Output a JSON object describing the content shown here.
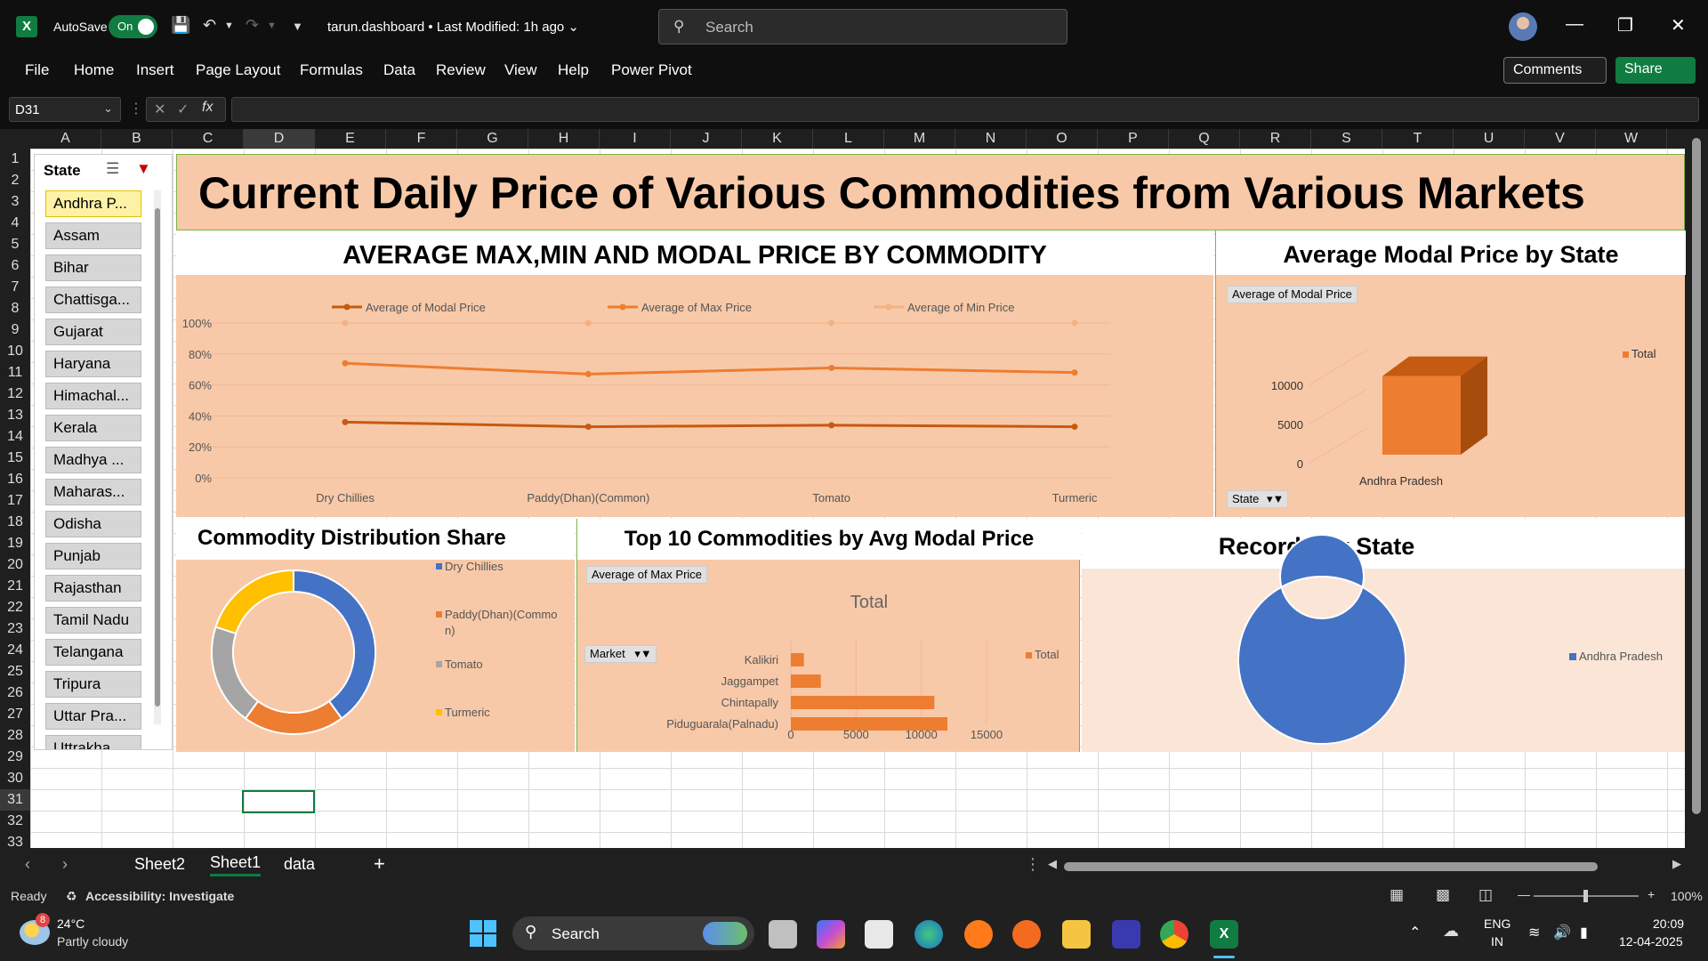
{
  "titlebar": {
    "autosave_label": "AutoSave",
    "autosave_state": "On",
    "doc_title": "tarun.dashboard  •  Last Modified: 1h ago",
    "search_placeholder": "Search"
  },
  "menu": {
    "items": [
      "File",
      "Home",
      "Insert",
      "Page Layout",
      "Formulas",
      "Data",
      "Review",
      "View",
      "Help",
      "Power Pivot"
    ],
    "comments": "Comments",
    "share": "Share"
  },
  "formula_bar": {
    "name_box": "D31",
    "formula": ""
  },
  "columns": [
    "A",
    "B",
    "C",
    "D",
    "E",
    "F",
    "G",
    "H",
    "I",
    "J",
    "K",
    "L",
    "M",
    "N",
    "O",
    "P",
    "Q",
    "R",
    "S",
    "T",
    "U",
    "V",
    "W"
  ],
  "rows": [
    "1",
    "2",
    "3",
    "4",
    "5",
    "6",
    "7",
    "8",
    "9",
    "10",
    "11",
    "12",
    "13",
    "14",
    "15",
    "16",
    "17",
    "18",
    "19",
    "20",
    "21",
    "22",
    "23",
    "24",
    "25",
    "26",
    "27",
    "28",
    "29",
    "30",
    "31",
    "32",
    "33"
  ],
  "slicer": {
    "title": "State",
    "items": [
      "Andhra P...",
      "Assam",
      "Bihar",
      "Chattisga...",
      "Gujarat",
      "Haryana",
      "Himachal...",
      "Kerala",
      "Madhya ...",
      "Maharas...",
      "Odisha",
      "Punjab",
      "Rajasthan",
      "Tamil Nadu",
      "Telangana",
      "Tripura",
      "Uttar Pra...",
      "Uttrakha..."
    ],
    "selected": 0
  },
  "dashboard": {
    "title": "Current Daily Price of Various Commodities from Various Markets",
    "colors": {
      "panel": "#f8c9a8",
      "orange": "#ed7d31",
      "dark_orange": "#c55a11",
      "blue": "#4472c4",
      "gray": "#a5a5a5",
      "yellow": "#ffc000",
      "accent_green": "#107c41"
    }
  },
  "chart_data": [
    {
      "type": "line",
      "title": "AVERAGE MAX,MIN AND MODAL PRICE BY COMMODITY",
      "categories": [
        "Dry Chillies",
        "Paddy(Dhan)(Common)",
        "Tomato",
        "Turmeric"
      ],
      "y_ticks": [
        "100%",
        "80%",
        "60%",
        "40%",
        "20%",
        "0%"
      ],
      "ylim": [
        0,
        100
      ],
      "series": [
        {
          "name": "Average of Modal Price",
          "color": "#c55a11",
          "values": [
            36,
            33,
            34,
            33
          ]
        },
        {
          "name": "Average of Max Price",
          "color": "#ed7d31",
          "values": [
            74,
            67,
            71,
            68
          ]
        },
        {
          "name": "Average of Min Price",
          "color": "#f4b183",
          "values": [
            100,
            100,
            100,
            100
          ]
        }
      ],
      "legend": "top"
    },
    {
      "type": "bar",
      "title": "Average Modal Price by State",
      "field_button": "Average of Modal Price",
      "filter_button": "State",
      "categories": [
        "Andhra Pradesh"
      ],
      "series": [
        {
          "name": "Total",
          "values": [
            8000
          ]
        }
      ],
      "y_ticks": [
        "10000",
        "5000",
        "0"
      ],
      "ylim": [
        0,
        10000
      ],
      "legend": "right"
    },
    {
      "type": "pie",
      "title": "Commodity Distribution Share",
      "categories": [
        "Dry Chillies",
        "Paddy(Dhan)(Commo n)",
        "Tomato",
        "Turmeric"
      ],
      "values": [
        40,
        20,
        20,
        20
      ],
      "colors": [
        "#4472c4",
        "#ed7d31",
        "#a5a5a5",
        "#ffc000"
      ],
      "legend": "right"
    },
    {
      "type": "bar",
      "title": "Top 10 Commodities by Avg Modal Price",
      "field_button": "Average of Max Price",
      "filter_button": "Market",
      "chart_title": "Total",
      "categories": [
        "Kalikiri",
        "Jaggampet",
        "Chintapally",
        "Piduguarala(Palnadu)"
      ],
      "values": [
        1000,
        2300,
        11000,
        12000
      ],
      "x_ticks": [
        "0",
        "5000",
        "10000",
        "15000"
      ],
      "xlim": [
        0,
        15000
      ],
      "series_name": "Total",
      "legend": "right"
    },
    {
      "type": "pie",
      "title": "Records by State",
      "categories": [
        "Andhra Pradesh"
      ],
      "values": [
        100
      ],
      "colors": [
        "#4472c4"
      ],
      "legend": "right"
    }
  ],
  "sheet_tabs": [
    "Sheet2",
    "Sheet1",
    "data"
  ],
  "active_tab": "Sheet1",
  "status": {
    "ready": "Ready",
    "accessibility": "Accessibility: Investigate",
    "zoom": "100%"
  },
  "taskbar": {
    "weather_temp": "24°C",
    "weather_desc": "Partly cloudy",
    "weather_badge": "8",
    "search": "Search",
    "lang1": "ENG",
    "lang2": "IN",
    "time": "20:09",
    "date": "12-04-2025"
  }
}
